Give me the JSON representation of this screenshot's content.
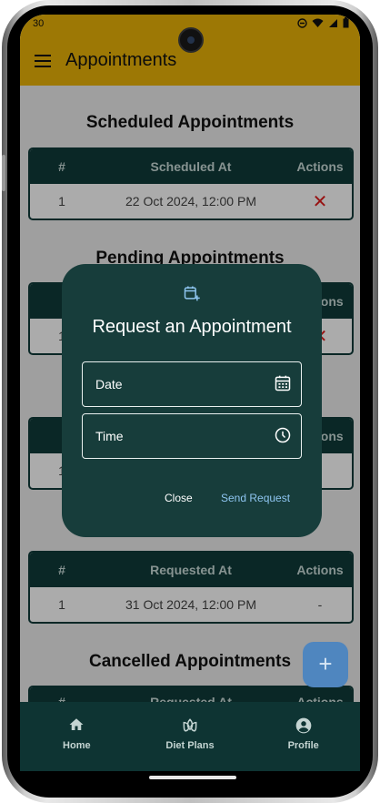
{
  "status": {
    "time": "30"
  },
  "app_bar": {
    "title": "Appointments",
    "menu_icon": "hamburger-icon"
  },
  "scheduled": {
    "title": "Scheduled Appointments",
    "headers": [
      "#",
      "Scheduled At",
      "Actions"
    ],
    "rows": [
      {
        "num": "1",
        "date": "22 Oct 2024, 12:00 PM",
        "action_icon": "close-x-icon"
      }
    ]
  },
  "pending": {
    "title": "Pending Appointments",
    "header_action": "Actions",
    "row_num": "1"
  },
  "hidden_table": {
    "header_action": "Actions",
    "row_num": "1",
    "row_action": "-"
  },
  "requested": {
    "headers": [
      "#",
      "Requested At",
      "Actions"
    ],
    "rows": [
      {
        "num": "1",
        "date": "31 Oct 2024, 12:00 PM",
        "action": "-"
      }
    ]
  },
  "cancelled": {
    "title": "Cancelled Appointments",
    "headers": [
      "#",
      "Requested At",
      "Actions"
    ]
  },
  "dialog": {
    "icon": "calendar-add-icon",
    "title": "Request an Appointment",
    "date_label": "Date",
    "time_label": "Time",
    "close_label": "Close",
    "send_label": "Send Request"
  },
  "fab": {
    "label": "+"
  },
  "bottom_nav": [
    {
      "label": "Home",
      "icon": "home-icon"
    },
    {
      "label": "Diet Plans",
      "icon": "lotus-icon"
    },
    {
      "label": "Profile",
      "icon": "account-circle-icon"
    }
  ],
  "colors": {
    "accent": "#eab308",
    "dark_teal": "#0f3b3a",
    "dialog_bg": "#173d3b",
    "link": "#8ec5f0",
    "danger": "#e11d1d"
  }
}
